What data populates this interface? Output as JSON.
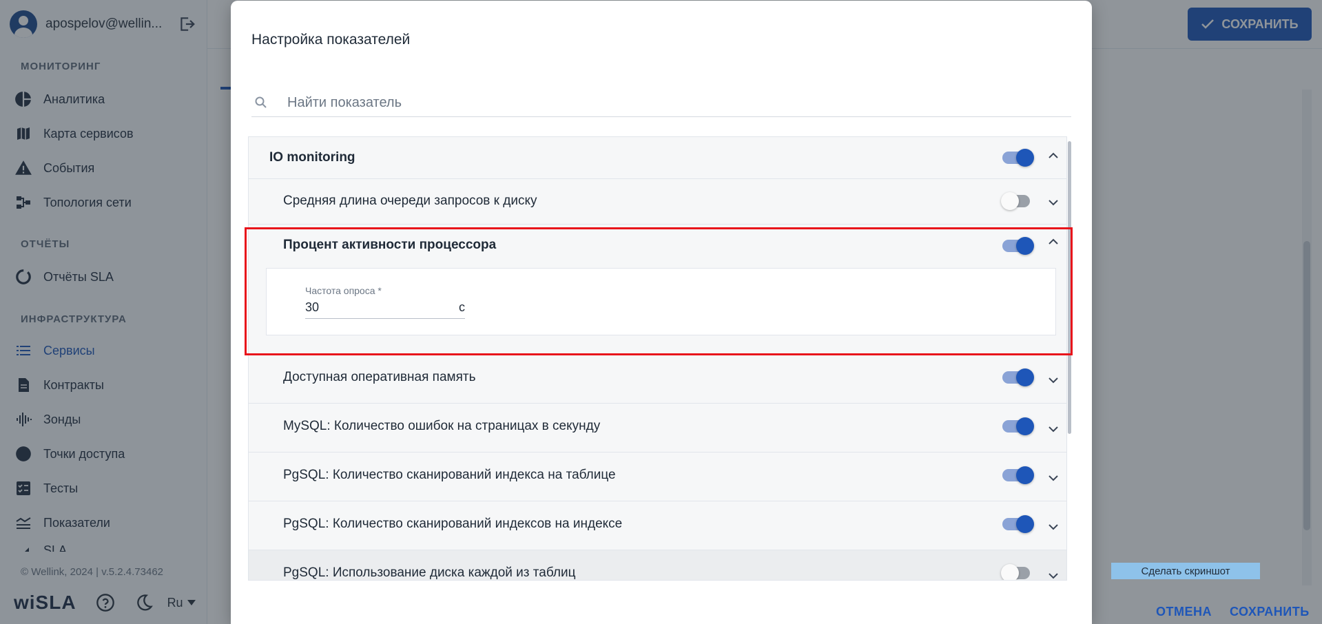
{
  "sidebar": {
    "user": "apospelov@wellin...",
    "sections": [
      {
        "title": "МОНИТОРИНГ",
        "items": [
          "Аналитика",
          "Карта сервисов",
          "События",
          "Топология сети"
        ]
      },
      {
        "title": "ОТЧЁТЫ",
        "items": [
          "Отчёты SLA"
        ]
      },
      {
        "title": "ИНФРАСТРУКТУРА",
        "items": [
          "Сервисы",
          "Контракты",
          "Зонды",
          "Точки доступа",
          "Тесты",
          "Показатели",
          "SLA"
        ]
      }
    ],
    "active_item": "Сервисы",
    "copyright": "© Wellink, 2024 | v.5.2.4.73462",
    "logo": "wiSLA",
    "language": "Ru"
  },
  "header": {
    "save_label": "СОХРАНИТЬ"
  },
  "dialog": {
    "title": "Настройка показателей",
    "search_placeholder": "Найти показатель",
    "group": {
      "label": "IO monitoring",
      "enabled": true
    },
    "metrics": [
      {
        "label": "Средняя длина очереди запросов к диску",
        "enabled": false
      },
      {
        "label": "Процент активности процессора",
        "enabled": true,
        "expanded": true
      },
      {
        "label": "Доступная оперативная память",
        "enabled": true
      },
      {
        "label": "MySQL: Количество ошибок на страницах в секунду",
        "enabled": true
      },
      {
        "label": "PgSQL: Количество сканирований индекса на таблице",
        "enabled": true
      },
      {
        "label": "PgSQL: Количество сканирований индексов на индексе",
        "enabled": true
      },
      {
        "label": "PgSQL: Использование диска каждой из таблиц",
        "enabled": false
      }
    ],
    "poll_frequency": {
      "label": "Частота опроса *",
      "value": "30",
      "unit": "с"
    },
    "tooltip": "Сделать скриншот",
    "cancel_label": "ОТМЕНА",
    "save_label": "СОХРАНИТЬ"
  },
  "colors": {
    "accent": "#1e56b8",
    "highlight": "#e8141b",
    "toggle_track": "#8aa3d6"
  }
}
